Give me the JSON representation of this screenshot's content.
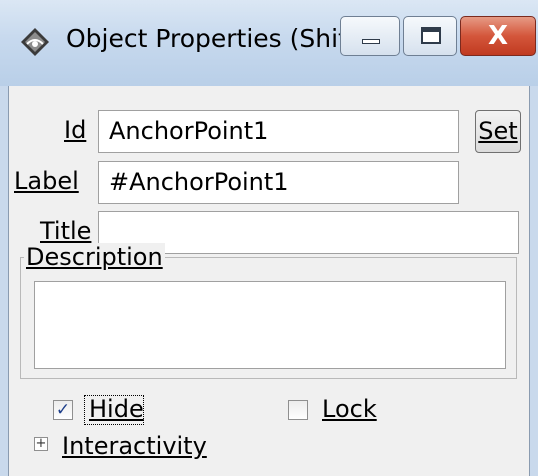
{
  "window": {
    "title": "Object Properties (Shif...",
    "controls": {
      "minimize_icon": "minimize-icon",
      "maximize_icon": "maximize-icon",
      "close_symbol": "X"
    }
  },
  "form": {
    "id_label": "Id",
    "id_value": "AnchorPoint1",
    "set_button_label": "Set",
    "label_label": "Label",
    "label_value": "#AnchorPoint1",
    "title_label": "Title",
    "title_value": "",
    "description_label": "Description",
    "description_value": ""
  },
  "options": {
    "hide_label": "Hide",
    "hide_checked": true,
    "lock_label": "Lock",
    "lock_checked": false
  },
  "sections": {
    "interactivity_label": "Interactivity",
    "interactivity_expander_symbol": "+"
  }
}
